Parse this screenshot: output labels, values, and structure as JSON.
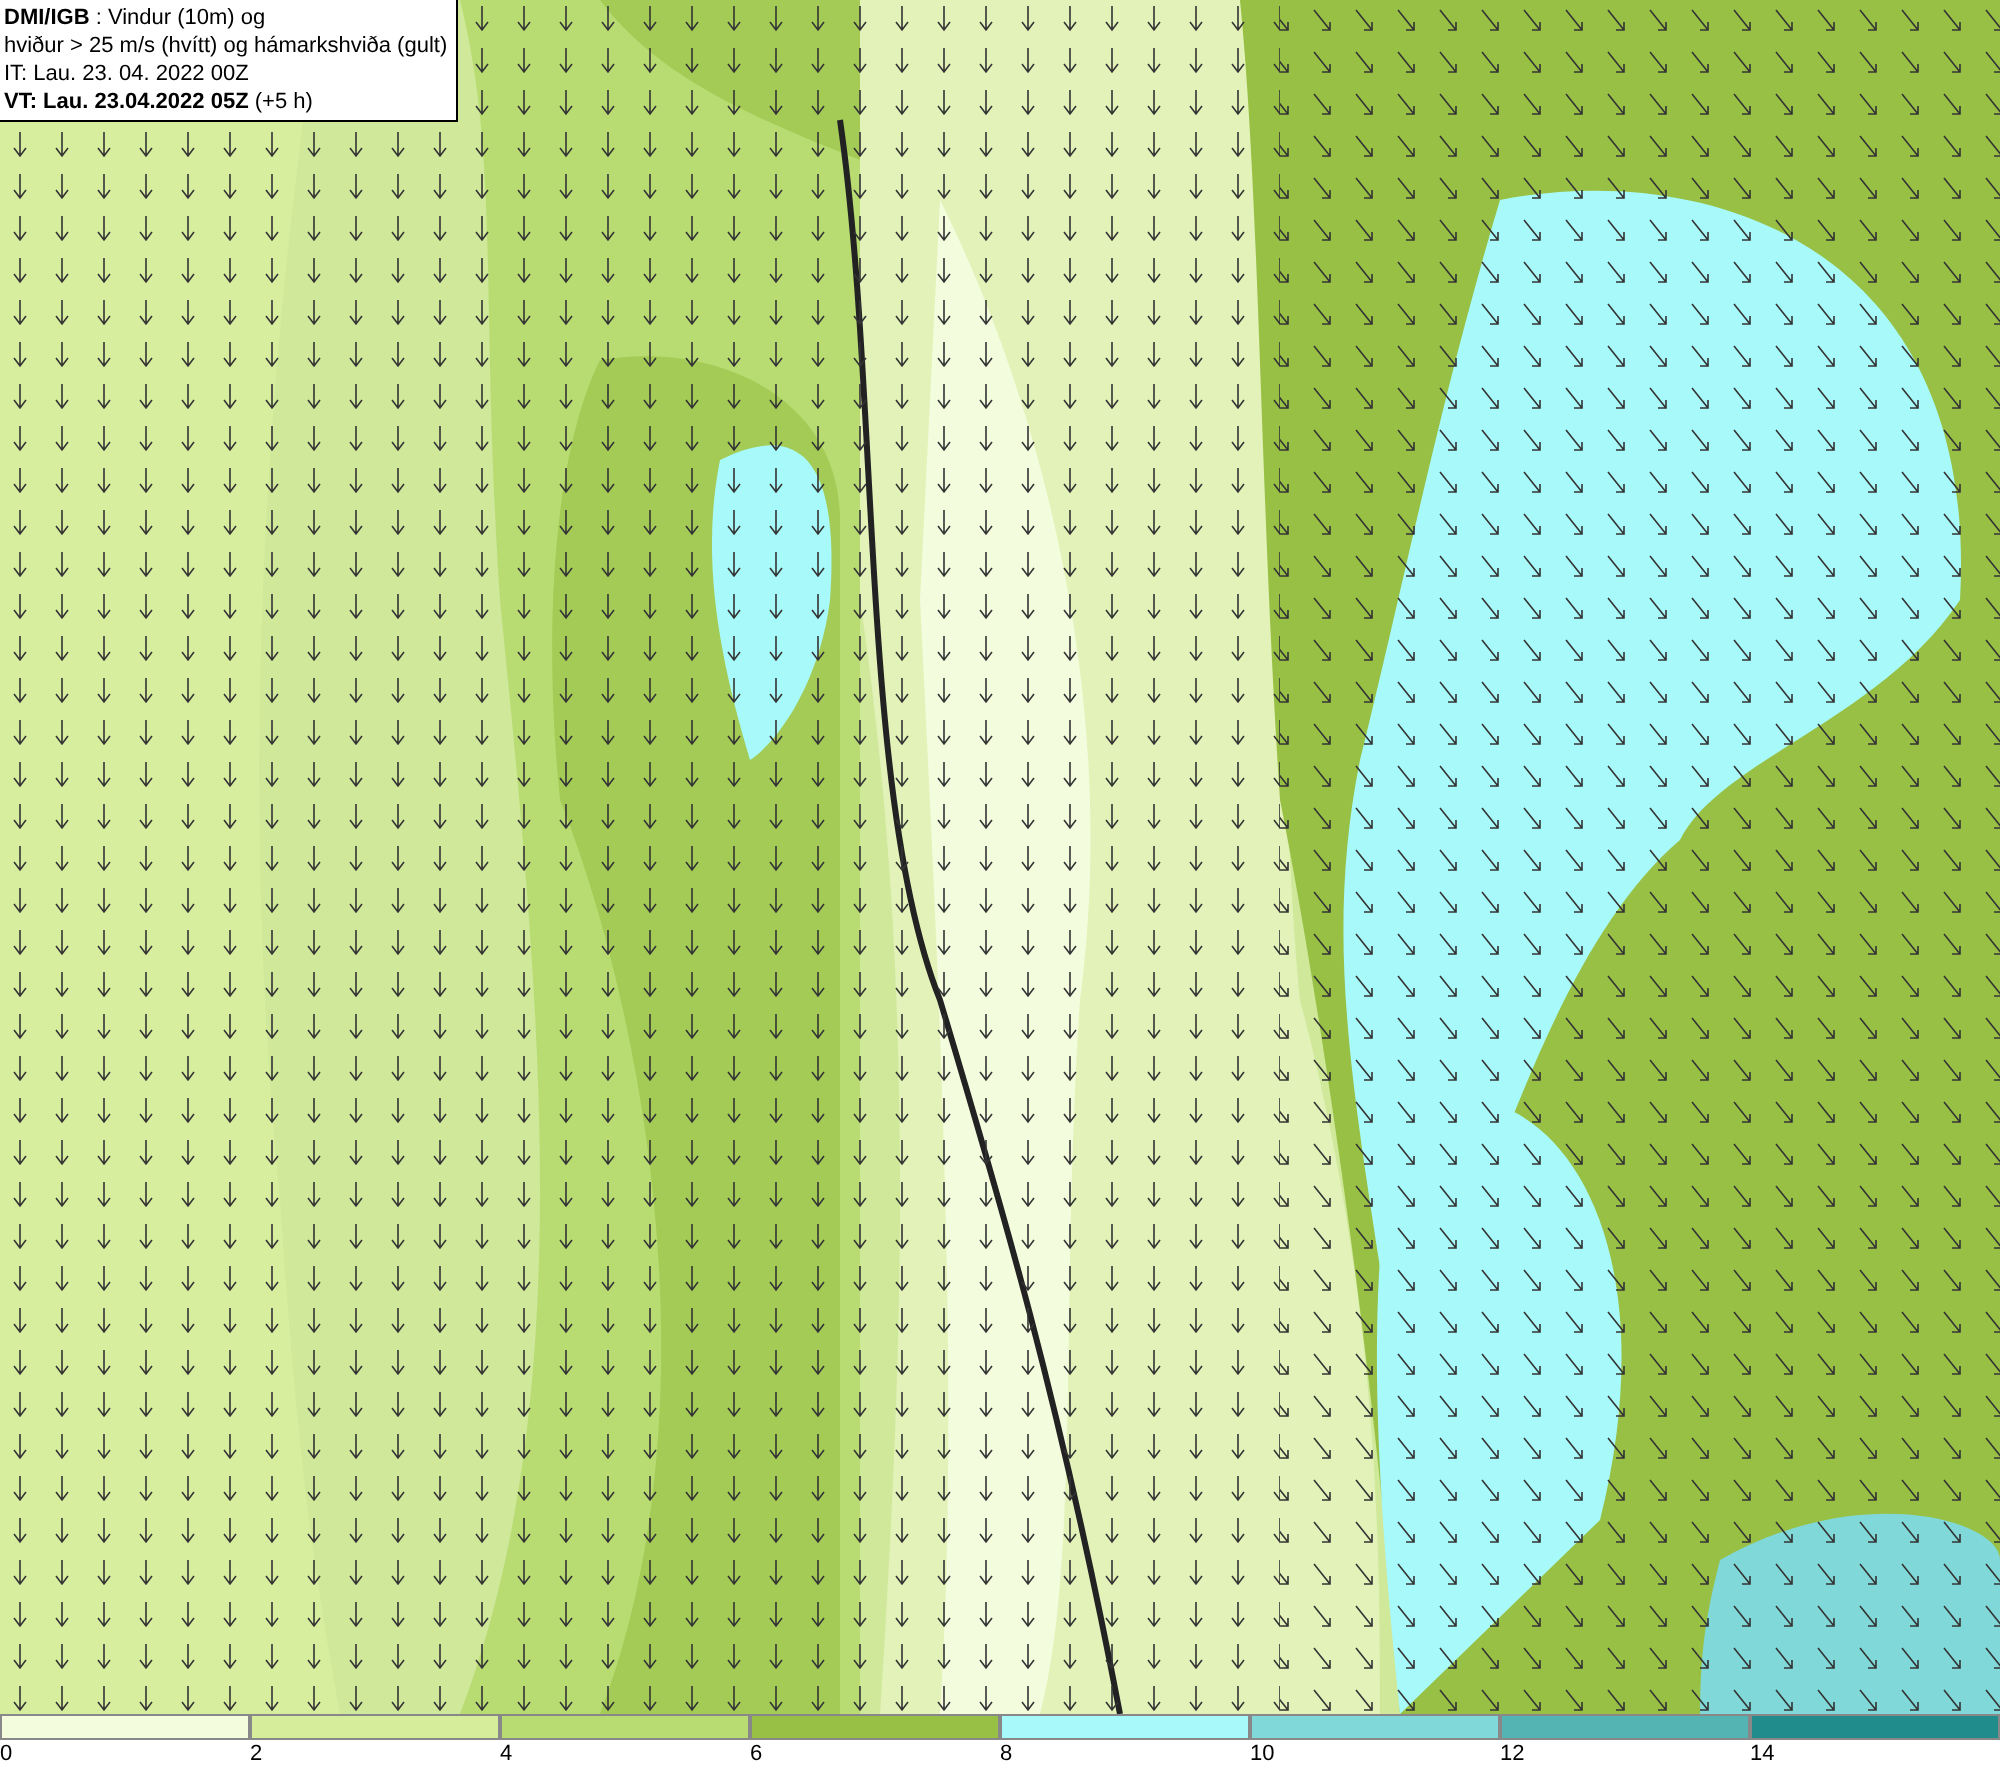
{
  "header": {
    "lines": [
      "**DMI/IGB** : Vindur (10m) og",
      "hviður > 25 m/s (hvítt) og hámarkshviða (gult)",
      "IT: Lau. 23. 04. 2022 00Z",
      "**VT: Lau. 23.04.2022 05Z** (+5 h)"
    ]
  },
  "legend": [
    {
      "color": "#f4fcde",
      "label": "0"
    },
    {
      "color": "#d6ee9c",
      "label": "2"
    },
    {
      "color": "#b8dc72",
      "label": "4"
    },
    {
      "color": "#98c045",
      "label": "6"
    },
    {
      "color": "#a8fafa",
      "label": "8"
    },
    {
      "color": "#80d8d8",
      "label": "10"
    },
    {
      "color": "#54b4b4",
      "label": "12"
    },
    {
      "color": "#218c8c",
      "label": "14"
    }
  ]
}
